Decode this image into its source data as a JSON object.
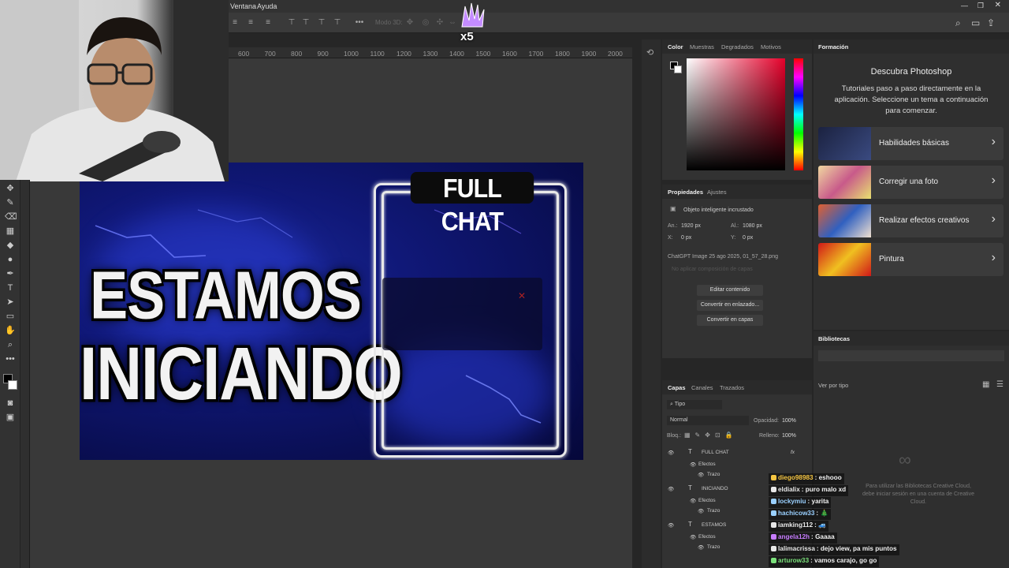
{
  "menubar": {
    "items": [
      "Ventana",
      "Ayuda"
    ]
  },
  "options": {
    "mode_label": "Modo 3D:"
  },
  "hruler": {
    "ticks": [
      "600",
      "700",
      "800",
      "900",
      "1000",
      "1100",
      "1200",
      "1300",
      "1400",
      "1500",
      "1600",
      "1700",
      "1800",
      "1900",
      "2000"
    ]
  },
  "overlay": {
    "combo_label": "x5"
  },
  "canvas": {
    "title_line1": "ESTAMOS",
    "title_line2": "INICIANDO",
    "chat_label": "FULL CHAT"
  },
  "color_panel": {
    "tabs": [
      "Color",
      "Muestras",
      "Degradados",
      "Motivos"
    ]
  },
  "properties_panel": {
    "tabs": [
      "Propiedades",
      "Ajustes"
    ],
    "object_type": "Objeto inteligente incrustado",
    "width_label": "An.:",
    "width_value": "1920 px",
    "height_label": "Al.:",
    "height_value": "1080 px",
    "x_label": "X:",
    "x_value": "0 px",
    "y_label": "Y:",
    "y_value": "0 px",
    "filename": "ChatGPT Image 25 ago 2025, 01_57_28.png",
    "layer_comp_placeholder": "No aplicar composición de capas",
    "buttons": [
      "Editar contenido",
      "Convertir en enlazado...",
      "Convertir en capas"
    ]
  },
  "layers_panel": {
    "tabs": [
      "Capas",
      "Canales",
      "Trazados"
    ],
    "filter": "Tipo",
    "blend_mode": "Normal",
    "opacity_label": "Opacidad:",
    "opacity_value": "100%",
    "lock_label": "Bloq.:",
    "fill_label": "Relleno:",
    "fill_value": "100%",
    "layers": [
      {
        "name": "FULL CHAT",
        "effects": "Efectos",
        "stroke": "Trazo"
      },
      {
        "name": "INICIANDO",
        "effects": "Efectos",
        "stroke": "Trazo"
      },
      {
        "name": "ESTAMOS",
        "effects": "Efectos",
        "stroke": "Trazo"
      }
    ]
  },
  "formation_panel": {
    "tab": "Formación",
    "title": "Descubra Photoshop",
    "description": "Tutoriales paso a paso directamente en la aplicación. Seleccione un tema a continuación para comenzar.",
    "cards": [
      "Habilidades básicas",
      "Corregir una foto",
      "Realizar efectos creativos",
      "Pintura"
    ]
  },
  "libraries_panel": {
    "tab": "Bibliotecas",
    "view_by": "Ver por tipo",
    "cloud_note": "Para utilizar las Bibliotecas Creative Cloud, debe iniciar sesión en una cuenta de Creative Cloud."
  },
  "chat": [
    {
      "user": "diego98983",
      "msg": "eshooo",
      "color": "#f5c542"
    },
    {
      "user": "eldialix",
      "msg": "puro malo xd",
      "color": "#e8e8e8"
    },
    {
      "user": "lockymiu",
      "msg": "yarita",
      "color": "#9ad0ff"
    },
    {
      "user": "hachicow33",
      "msg": "🎄",
      "color": "#9ad0ff"
    },
    {
      "user": "iamking112",
      "msg": "🚙",
      "color": "#e8e8e8"
    },
    {
      "user": "angela12h",
      "msg": "Gaaaa",
      "color": "#c77dff"
    },
    {
      "user": "lalimacrissa",
      "msg": "dejo view, pa mis puntos",
      "color": "#e8e8e8"
    },
    {
      "user": "arturow33",
      "msg": "vamos carajo, go go",
      "color": "#7be07b"
    }
  ]
}
